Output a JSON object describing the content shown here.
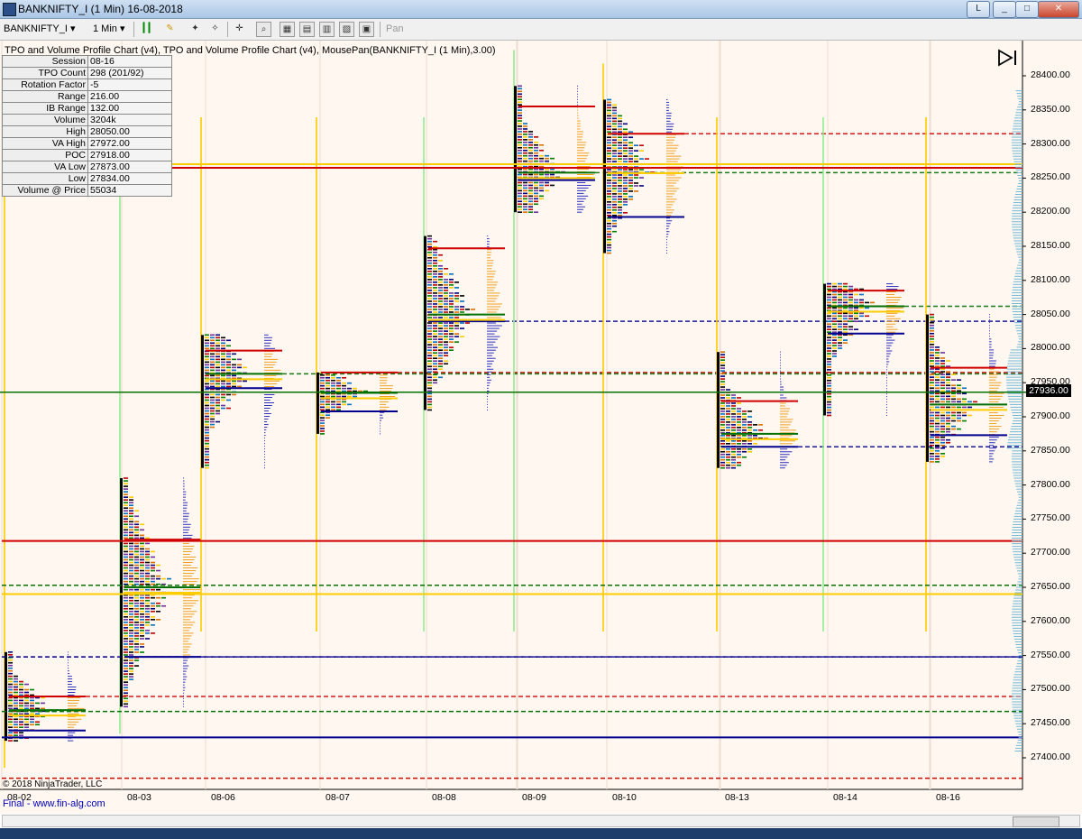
{
  "window": {
    "title": "BANKNIFTY_I (1 Min)  16-08-2018",
    "buttons": [
      "L",
      "_",
      "□",
      "✕"
    ]
  },
  "toolbar": {
    "instrument": "BANKNIFTY_I",
    "interval": "1 Min",
    "pan_label": "Pan"
  },
  "chart": {
    "header": "TPO and Volume Profile Chart (v4),  TPO and Volume Profile Chart (v4), MousePan(BANKNIFTY_I (1 Min),3.00)",
    "info": [
      {
        "k": "Session",
        "v": "08-16"
      },
      {
        "k": "TPO Count",
        "v": "298 (201/92)"
      },
      {
        "k": "Rotation Factor",
        "v": "-5"
      },
      {
        "k": "Range",
        "v": "216.00"
      },
      {
        "k": "IB Range",
        "v": "132.00"
      },
      {
        "k": "Volume",
        "v": "3204k"
      },
      {
        "k": "High",
        "v": "28050.00"
      },
      {
        "k": "VA High",
        "v": "27972.00"
      },
      {
        "k": "POC",
        "v": "27918.00"
      },
      {
        "k": "VA Low",
        "v": "27873.00"
      },
      {
        "k": "Low",
        "v": "27834.00"
      },
      {
        "k": "Volume @ Price",
        "v": "55034"
      }
    ],
    "y_ticks": [
      "28400.00",
      "28350.00",
      "28300.00",
      "28250.00",
      "28200.00",
      "28150.00",
      "28100.00",
      "28050.00",
      "28000.00",
      "27950.00",
      "27900.00",
      "27850.00",
      "27800.00",
      "27750.00",
      "27700.00",
      "27650.00",
      "27600.00",
      "27550.00",
      "27500.00",
      "27450.00",
      "27400.00"
    ],
    "y_range": [
      27360,
      28440
    ],
    "x_ticks": [
      "08-02",
      "08-03",
      "08-06",
      "08-07",
      "08-08",
      "08-09",
      "08-10",
      "08-13",
      "08-14",
      "08-16"
    ],
    "current_price": "27936.00",
    "copyright": "© 2018 NinjaTrader, LLC",
    "website": "Final - www.fin-alg.com"
  },
  "chart_data": {
    "type": "table",
    "y_range": [
      27360,
      28440
    ],
    "sessions": [
      {
        "date": "08-02",
        "high": 27555,
        "low": 27425,
        "poc": 27470,
        "vah": 27490,
        "val": 27440
      },
      {
        "date": "08-03",
        "high": 27810,
        "low": 27475,
        "poc": 27650,
        "vah": 27720,
        "val": 27548
      },
      {
        "date": "08-06",
        "high": 28020,
        "low": 27825,
        "poc": 27963,
        "vah": 27997,
        "val": 27942
      },
      {
        "date": "08-07",
        "high": 27965,
        "low": 27875,
        "poc": 27935,
        "vah": 27965,
        "val": 27908
      },
      {
        "date": "08-08",
        "high": 28165,
        "low": 27910,
        "poc": 28050,
        "vah": 28147,
        "val": 28040
      },
      {
        "date": "08-09",
        "high": 28385,
        "low": 28200,
        "poc": 28258,
        "vah": 28355,
        "val": 28247
      },
      {
        "date": "08-10",
        "high": 28365,
        "low": 28140,
        "poc": 28265,
        "vah": 28315,
        "val": 28193
      },
      {
        "date": "08-13",
        "high": 27995,
        "low": 27825,
        "poc": 27875,
        "vah": 27923,
        "val": 27856
      },
      {
        "date": "08-14",
        "high": 28095,
        "low": 27902,
        "poc": 28062,
        "vah": 28085,
        "val": 28022
      },
      {
        "date": "08-16",
        "high": 28050,
        "low": 27834,
        "poc": 27918,
        "vah": 27972,
        "val": 27873
      }
    ],
    "current_price": 27936
  }
}
